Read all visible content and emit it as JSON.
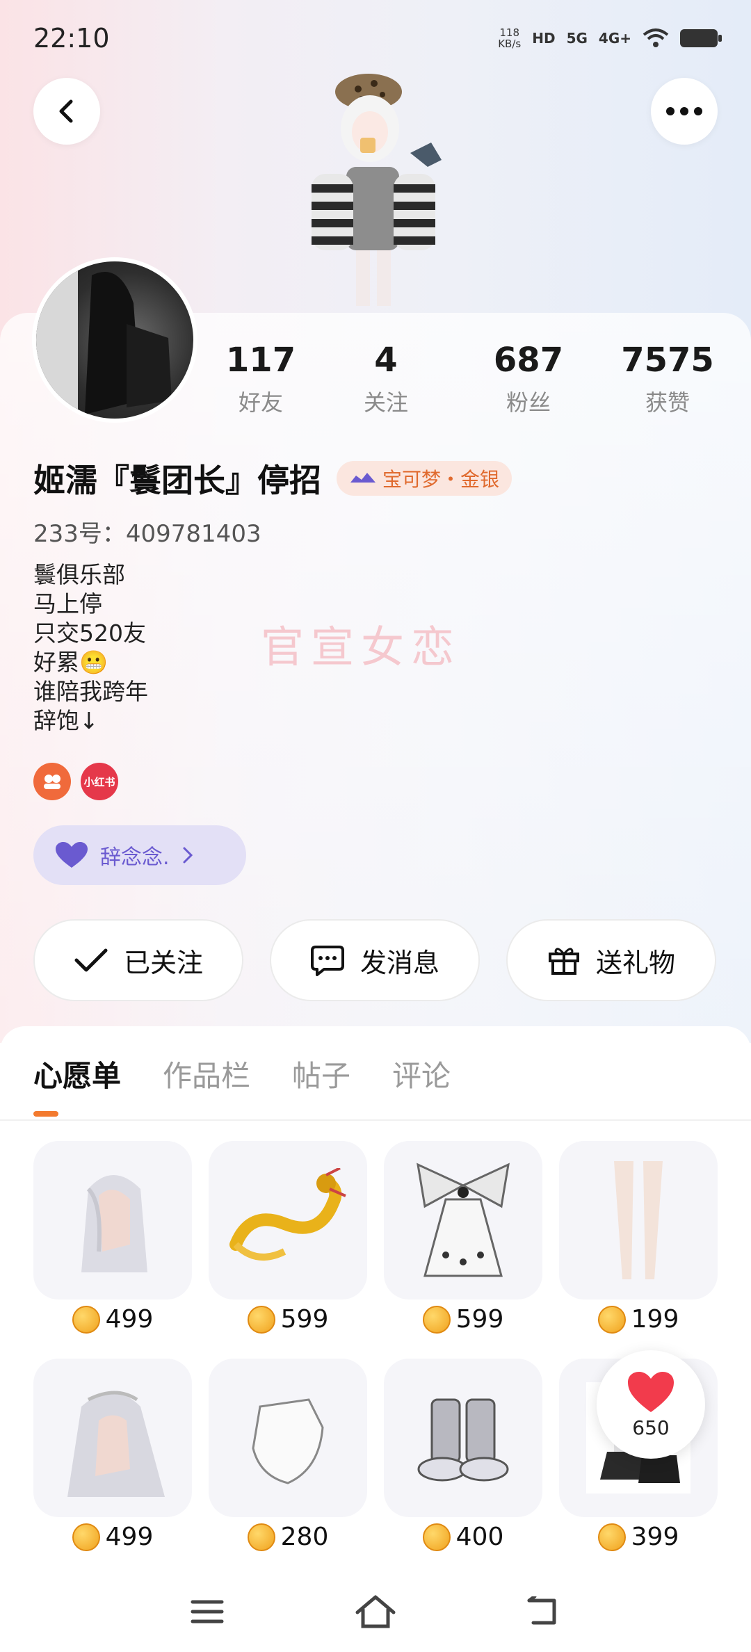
{
  "status_bar": {
    "time": "22:10",
    "net_speed_value": "118",
    "net_speed_unit": "KB/s",
    "hd_label": "HD",
    "sim1": "5G",
    "sim2": "4G+"
  },
  "profile": {
    "stats": [
      {
        "value": "117",
        "label": "好友"
      },
      {
        "value": "4",
        "label": "关注"
      },
      {
        "value": "687",
        "label": "粉丝"
      },
      {
        "value": "7575",
        "label": "获赞"
      }
    ],
    "name": "姬濡『鬟团长』停招",
    "badge": "宝可梦・金银",
    "uid": "233号：409781403",
    "bio": [
      "鬟俱乐部",
      "马上停",
      "只交520友",
      "好累😬",
      "谁陪我跨年",
      "辞饱↓"
    ],
    "watermark": "官宣女恋",
    "social": {
      "xiaohongshu": "小红书"
    },
    "cp_name": "辞念念.",
    "actions": {
      "follow": "已关注",
      "message": "发消息",
      "gift": "送礼物"
    }
  },
  "tabs": [
    "心愿单",
    "作品栏",
    "帖子",
    "评论"
  ],
  "wishlist": [
    {
      "icon": "white-hair-item",
      "price": "499"
    },
    {
      "icon": "golden-dragon-item",
      "price": "599"
    },
    {
      "icon": "butterfly-dress-item",
      "price": "599"
    },
    {
      "icon": "white-stockings-item",
      "price": "199"
    },
    {
      "icon": "silver-hair-item",
      "price": "499"
    },
    {
      "icon": "white-glove-item",
      "price": "280"
    },
    {
      "icon": "grey-boots-item",
      "price": "400"
    },
    {
      "icon": "black-shoes-item",
      "price": "399"
    }
  ],
  "like_bubble": {
    "count": "650"
  },
  "colors": {
    "accent": "#f37a2f",
    "cp_purple": "#6a5ad0",
    "badge_orange": "#e06a2e",
    "like_red": "#f23b4c"
  }
}
